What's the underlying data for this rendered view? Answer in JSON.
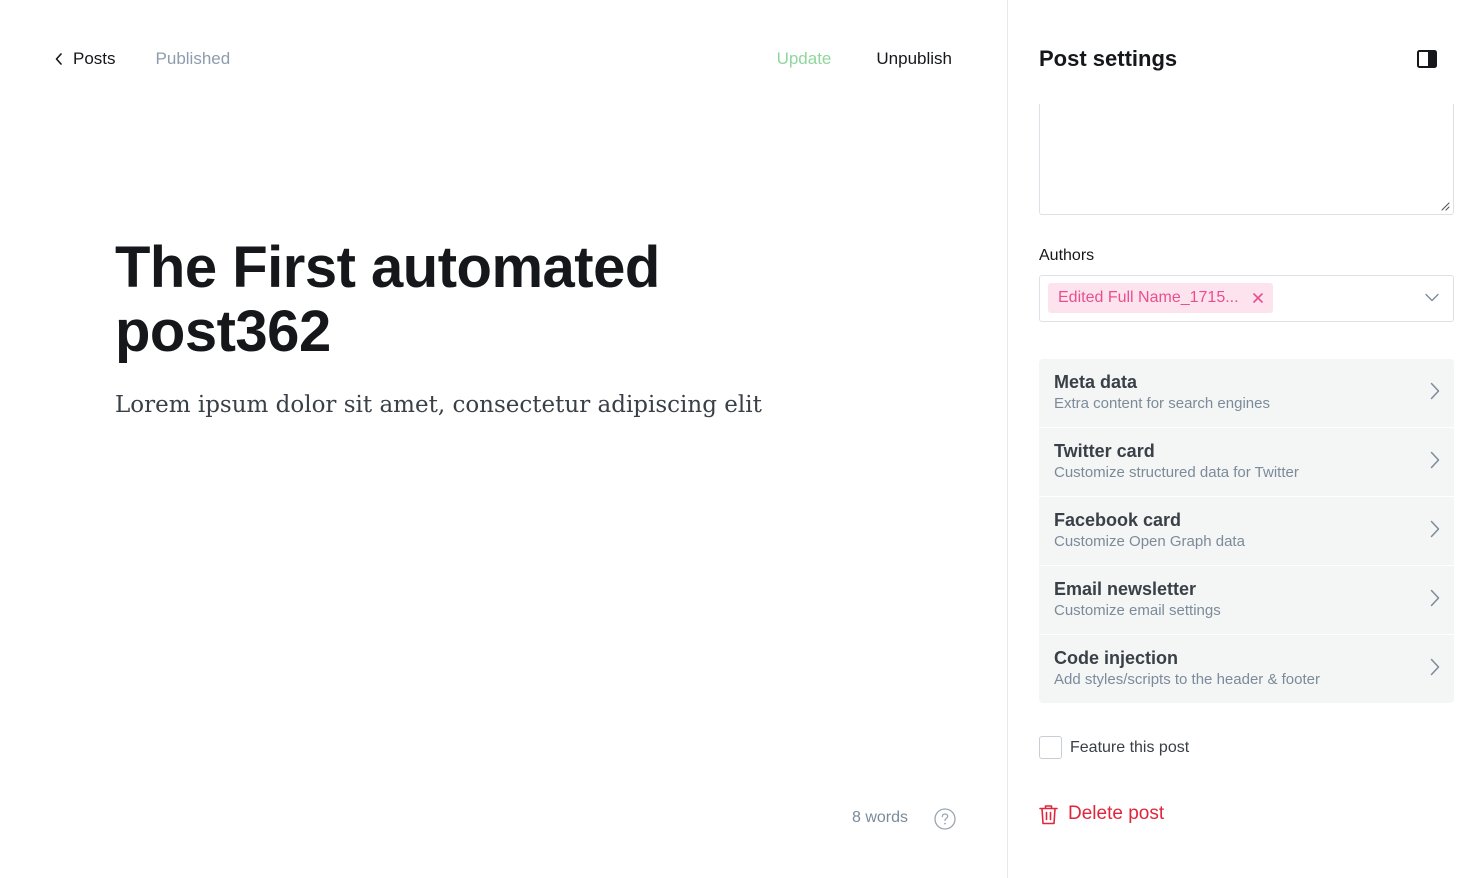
{
  "header": {
    "back_label": "Posts",
    "status": "Published",
    "update_label": "Update",
    "unpublish_label": "Unpublish"
  },
  "post": {
    "title": "The First automated post362",
    "excerpt": "Lorem ipsum dolor sit amet, consectetur adipiscing elit"
  },
  "footer": {
    "word_count": "8 words"
  },
  "settings": {
    "title": "Post settings",
    "authors_label": "Authors",
    "author_token": "Edited Full Name_1715...",
    "menu": [
      {
        "title": "Meta data",
        "desc": "Extra content for search engines"
      },
      {
        "title": "Twitter card",
        "desc": "Customize structured data for Twitter"
      },
      {
        "title": "Facebook card",
        "desc": "Customize Open Graph data"
      },
      {
        "title": "Email newsletter",
        "desc": "Customize email settings"
      },
      {
        "title": "Code injection",
        "desc": "Add styles/scripts to the header & footer"
      }
    ],
    "feature_label": "Feature this post",
    "delete_label": "Delete post"
  },
  "colors": {
    "update_green": "#8fd79c",
    "token_bg": "#fde3ee",
    "token_text": "#e94f8f",
    "delete_red": "#e0263c",
    "menu_bg": "#f4f5f5"
  },
  "icons": {
    "back": "chevron-left-icon",
    "help": "question-circle-icon",
    "panel": "sidebar-toggle-icon",
    "remove_token": "close-icon",
    "dropdown": "chevron-down-icon",
    "menu_arrow": "chevron-right-icon",
    "delete": "trash-icon"
  }
}
